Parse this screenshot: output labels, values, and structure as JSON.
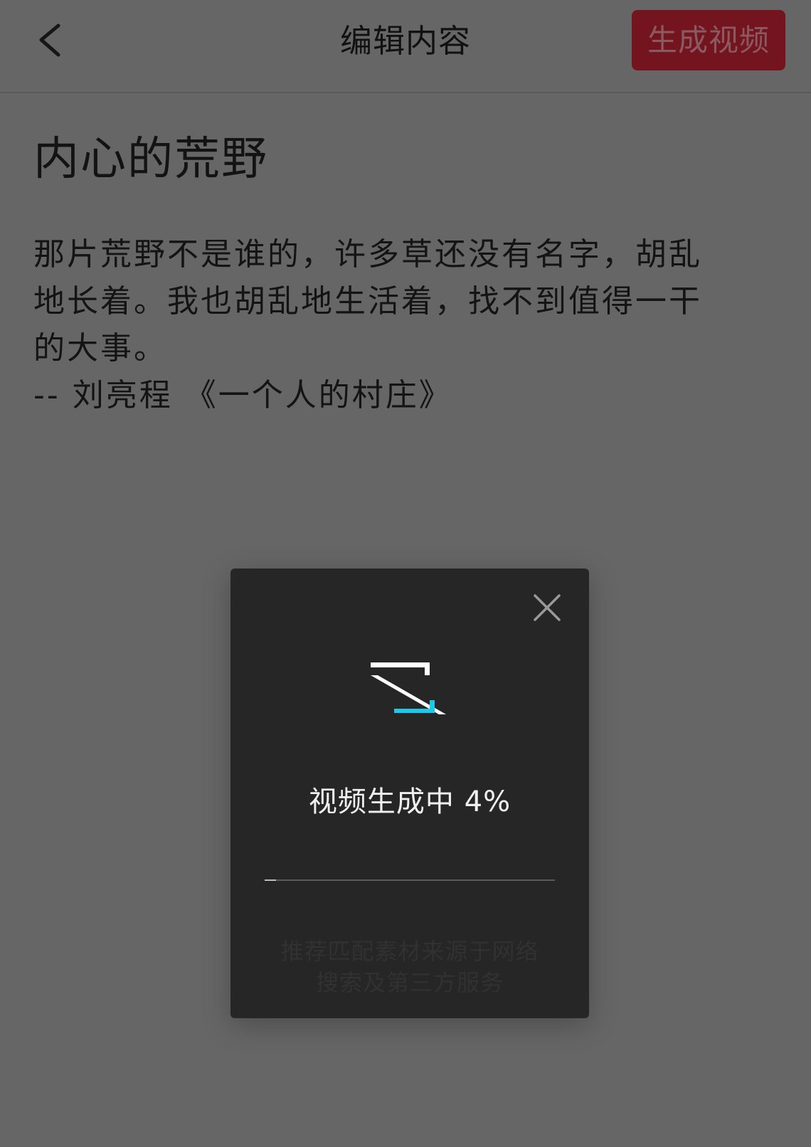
{
  "header": {
    "title": "编辑内容",
    "generate_label": "生成视频",
    "back_icon": "chevron-left-icon"
  },
  "content": {
    "title": "内心的荒野",
    "body_lines": [
      "那片荒野不是谁的，许多草还没有名字，胡乱",
      "地长着。我也胡乱地生活着，找不到值得一干",
      "的大事。",
      "-- 刘亮程 《一个人的村庄》"
    ]
  },
  "modal": {
    "close_icon": "close-icon",
    "logo_icon": "app-logo-icon",
    "status": "视频生成中 4%",
    "progress": 0.04,
    "note_lines": [
      "推荐匹配素材来源于网络",
      "搜索及第三方服务"
    ]
  },
  "colors": {
    "background": "#666666",
    "accent": "#74141f",
    "modal_bg": "#262626",
    "logo_cyan": "#1ec8e6"
  }
}
